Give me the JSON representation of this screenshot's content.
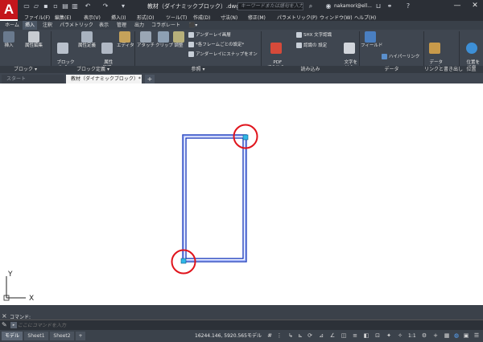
{
  "app": {
    "logo": "A"
  },
  "window": {
    "title": "教材（ダイナミックブロック）.dwg",
    "search_placeholder": "キーワードまたは語句を入力",
    "user": "nakamori@ell...",
    "minimize": "—",
    "close": "✕"
  },
  "menu": {
    "items": [
      "ファイル(F)",
      "編集(E)",
      "表示(V)",
      "挿入(I)",
      "形式(O)",
      "ツール(T)",
      "作成(D)",
      "寸法(N)",
      "修正(M)",
      "パラメトリック(P)",
      "ウィンドウ(W)",
      "ヘルプ(H)"
    ]
  },
  "ribbon_tabs": [
    "ホーム",
    "挿入",
    "注釈",
    "パラメトリック",
    "表示",
    "管理",
    "出力",
    "コラボレート",
    "⬛▾"
  ],
  "ribbon": {
    "insert_label": "挿入",
    "edit_attribute_label": "属性編集",
    "create_block_label": "ブロック\n作成",
    "define_attribute_label": "属性定義",
    "manage_attributes_label": "属性\n管理",
    "block_editor_label": "エディタ",
    "attach_label": "アタッチ",
    "clip_label": "クリップ",
    "adjust_label": "調整",
    "underlay_layers_label": "アンダーレイ画層",
    "frames_label": "*各フレームごとの設定*",
    "snap_underlay_label": "アンダーレイにスナップをオン",
    "pdf_import_label": "PDF\n読み込み",
    "shx_label": "SHX 文字認識",
    "recognition_settings_label": "認識の 設定",
    "combine_text_label": "文字を\n結合",
    "field_label": "フィールド",
    "hyperlink_label": "ハイパーリンク",
    "data_link_label": "データ\nリンク",
    "set_location_label": "位置を\n設定"
  },
  "ribbon_panels": {
    "block": "ブロック ▾",
    "block_definition": "ブロック定義 ▾",
    "reference": "参照 ▾",
    "import": "読み込み",
    "data": "データ",
    "link_extract": "リンクと書き出し",
    "location": "位置"
  },
  "doc_tabs": {
    "start": "スタート",
    "drawing": "教材（ダイナミックブロック）*",
    "drawing_close": "×",
    "new_tab": "+"
  },
  "canvas": {
    "ucs_x": "X",
    "ucs_y": "Y"
  },
  "command": {
    "history_label": "コマンド:",
    "placeholder": "ここにコマンドを入力",
    "close_icon": "×",
    "wrench_icon": "🔧"
  },
  "status": {
    "layout_tabs": [
      "モデル",
      "Sheet1",
      "Sheet2",
      "+"
    ],
    "coords": "16244.146, 5920.565",
    "model": "モデル",
    "scale": "1:1"
  },
  "colors": {
    "rect_stroke": "#1f3fbf",
    "grip": "#2fb7e8",
    "highlight_circle": "#e0141c"
  }
}
